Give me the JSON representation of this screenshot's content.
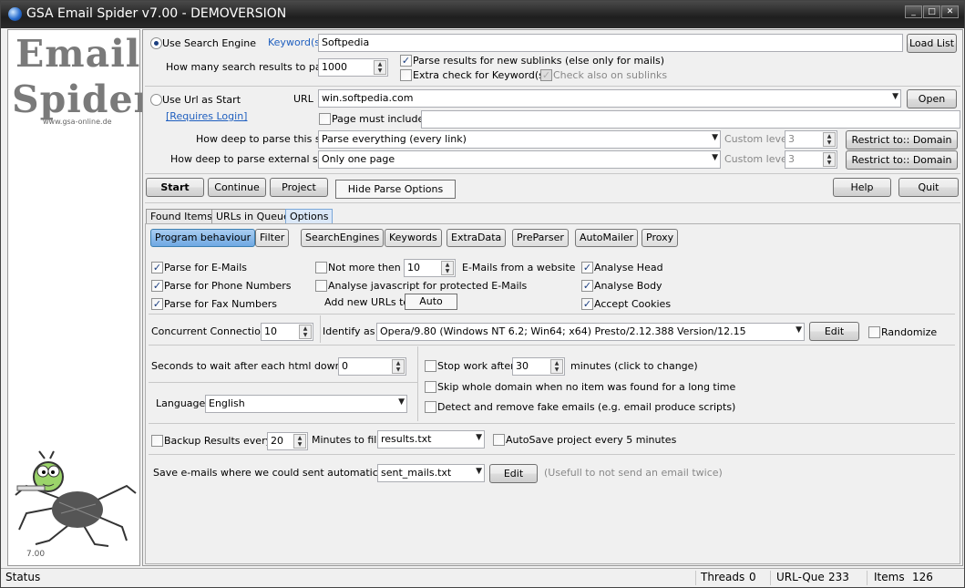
{
  "window": {
    "title": "GSA Email Spider v7.00 - DEMOVERSION",
    "controls": [
      "_",
      "□",
      "✕"
    ]
  },
  "logo": {
    "line1": "Email",
    "line2": "Spider",
    "url": "www.gsa-online.de",
    "version": "7.00"
  },
  "search": {
    "use_search_engine": "Use Search Engine",
    "keywords_link": "Keyword(s)",
    "keywords_value": "Softpedia",
    "load_list": "Load List",
    "results_label": "How many search results to parse",
    "results_value": "1000",
    "parse_sublinks": "Parse results for new sublinks (else only for mails)",
    "extra_check": "Extra check for Keyword(s)",
    "check_sublinks": "Check also on sublinks"
  },
  "url": {
    "use_url": "Use Url as Start",
    "url_label": "URL",
    "url_value": "win.softpedia.com",
    "open": "Open",
    "requires_login": "[Requires Login]",
    "page_must_include": "Page must include",
    "deep_site_label": "How deep to parse this site",
    "deep_site_value": "Parse everything (every link)",
    "custom_level": "Custom level",
    "custom_value": "3",
    "restrict": "Restrict to:: Domain",
    "deep_ext_label": "How deep to parse external sites",
    "deep_ext_value": "Only one page",
    "custom_level2": "Custom level",
    "custom_value2": "3",
    "restrict2": "Restrict to:: Domain"
  },
  "actions": {
    "start": "Start",
    "continue": "Continue",
    "project": "Project",
    "hide_parse": "Hide Parse Options",
    "help": "Help",
    "quit": "Quit"
  },
  "tabs": [
    "Found Items",
    "URLs in Queue",
    "Options"
  ],
  "subtabs": [
    "Program behaviour",
    "Filter",
    "SearchEngines",
    "Keywords",
    "ExtraData",
    "PreParser",
    "AutoMailer",
    "Proxy"
  ],
  "options": {
    "parse_emails": "Parse for E-Mails",
    "parse_phone": "Parse for Phone Numbers",
    "parse_fax": "Parse for Fax Numbers",
    "not_more": "Not more then",
    "not_more_value": "10",
    "emails_from_site": "E-Mails from a website",
    "analyse_js": "Analyse javascript for protected E-Mails",
    "add_new_urls": "Add new URLs to",
    "auto": "Auto",
    "analyse_head": "Analyse Head",
    "analyse_body": "Analyse Body",
    "accept_cookies": "Accept Cookies",
    "concurrent_label": "Concurrent Connections",
    "concurrent_value": "10",
    "identify_label": "Identify as",
    "identify_value": "Opera/9.80 (Windows NT 6.2; Win64; x64) Presto/2.12.388 Version/12.15",
    "edit": "Edit",
    "randomize": "Randomize",
    "seconds_label": "Seconds to wait after each html download",
    "seconds_value": "0",
    "stop_work": "Stop work after",
    "stop_value": "30",
    "minutes_label": "minutes (click to change)",
    "skip_domain": "Skip whole domain when no item was found for a long time",
    "detect_fake": "Detect and remove fake emails (e.g. email produce scripts)",
    "language_label": "Language",
    "language_value": "English",
    "backup_label": "Backup Results every",
    "backup_value": "20",
    "minutes_to_file": "Minutes to file",
    "file_value": "results.txt",
    "autosave": "AutoSave project every 5 minutes",
    "save_label": "Save e-mails where we could sent automatically to",
    "sent_file": "sent_mails.txt",
    "edit2": "Edit",
    "useful_note": "(Usefull to not send an email twice)"
  },
  "status": {
    "status": "Status",
    "threads_label": "Threads",
    "threads_value": "0",
    "urlque_label": "URL-Que",
    "urlque_value": "233",
    "items_label": "Items",
    "items_value": "126"
  }
}
